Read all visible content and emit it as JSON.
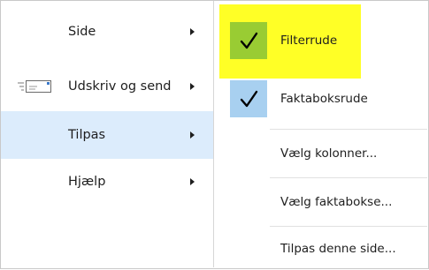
{
  "menu": {
    "items": [
      {
        "label": "Side",
        "has_submenu": true
      },
      {
        "label": "Udskriv og send",
        "has_submenu": true,
        "icon": "print-send-icon"
      },
      {
        "label": "Tilpas",
        "has_submenu": true,
        "selected": true
      },
      {
        "label": "Hjælp",
        "has_submenu": true
      }
    ]
  },
  "submenu": {
    "items": [
      {
        "label": "Filterrude",
        "checked": true,
        "highlighted": true
      },
      {
        "label": "Faktaboksrude",
        "checked": true
      },
      {
        "label": "Vælg kolonner..."
      },
      {
        "label": "Vælg faktabokse..."
      },
      {
        "label": "Tilpas denne side..."
      }
    ]
  },
  "colors": {
    "highlight": "#ffff26",
    "check_green": "#99cc33",
    "check_blue": "#a8d0f0",
    "selected_item": "#dcecfc"
  }
}
